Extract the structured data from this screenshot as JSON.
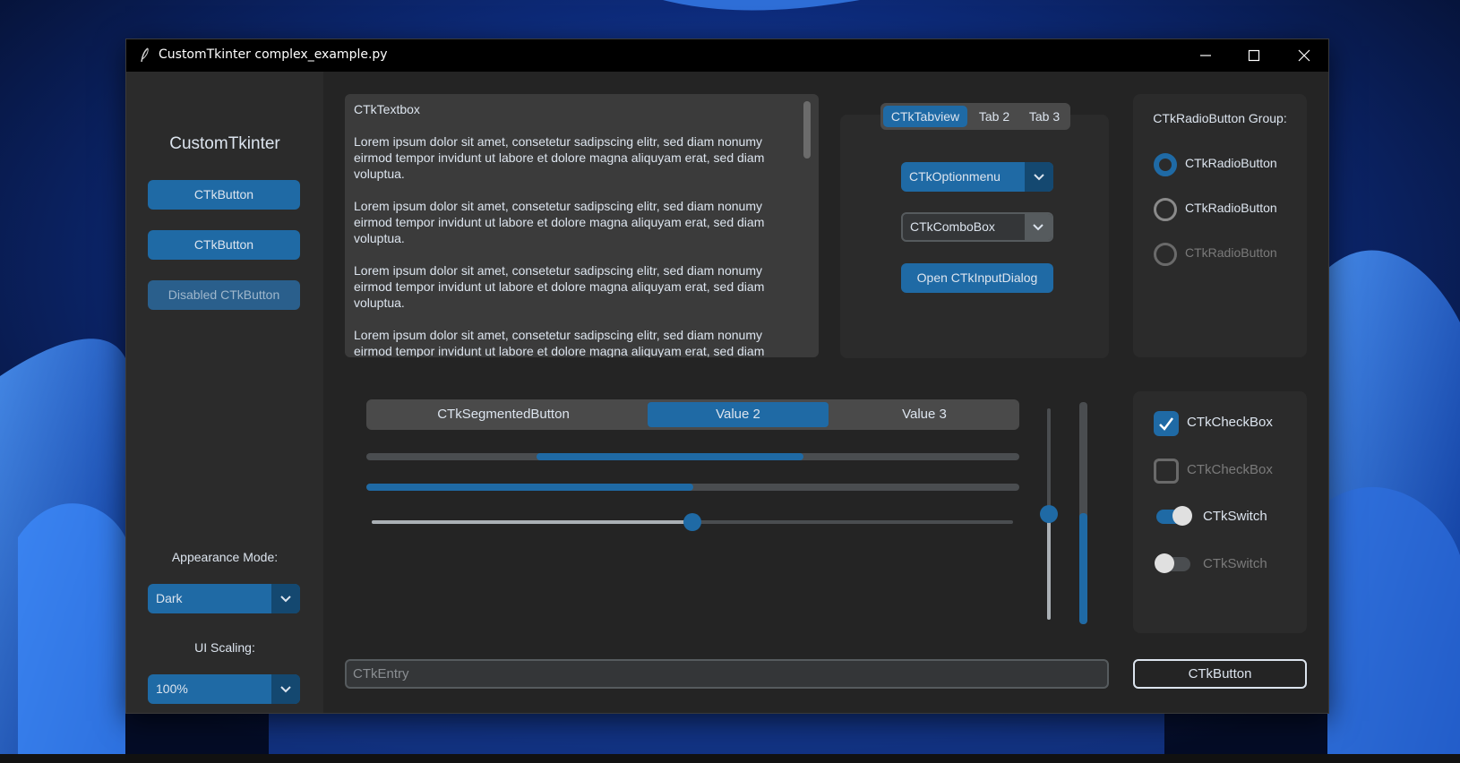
{
  "colors": {
    "accent": "#1f6aa5",
    "accent_dark": "#144870",
    "window_bg": "#242424",
    "frame_bg": "#2b2b2b",
    "text": "#dce4ee",
    "disabled_text": "#7a7a7a"
  },
  "window": {
    "title": "CustomTkinter complex_example.py",
    "icon": "feather-icon"
  },
  "sidebar": {
    "logo": "CustomTkinter",
    "buttons": [
      "CTkButton",
      "CTkButton",
      "Disabled CTkButton"
    ],
    "appearance_label": "Appearance Mode:",
    "appearance_value": "Dark",
    "scaling_label": "UI Scaling:",
    "scaling_value": "100%"
  },
  "textbox": {
    "header": "CTkTextbox",
    "paragraphs": [
      "Lorem ipsum dolor sit amet, consetetur sadipscing elitr, sed diam nonumy eirmod tempor invidunt ut labore et dolore magna aliquyam erat, sed diam voluptua.",
      "Lorem ipsum dolor sit amet, consetetur sadipscing elitr, sed diam nonumy eirmod tempor invidunt ut labore et dolore magna aliquyam erat, sed diam voluptua.",
      "Lorem ipsum dolor sit amet, consetetur sadipscing elitr, sed diam nonumy eirmod tempor invidunt ut labore et dolore magna aliquyam erat, sed diam voluptua.",
      "Lorem ipsum dolor sit amet, consetetur sadipscing elitr, sed diam nonumy eirmod tempor invidunt ut labore et dolore magna aliquyam erat, sed diam voluptua."
    ]
  },
  "tabview": {
    "tabs": [
      "CTkTabview",
      "Tab 2",
      "Tab 3"
    ],
    "active_tab": 0,
    "optionmenu_value": "CTkOptionmenu",
    "combobox_value": "CTkComboBox",
    "dialog_button": "Open CTkInputDialog"
  },
  "radio_group": {
    "title": "CTkRadioButton Group:",
    "items": [
      {
        "label": "CTkRadioButton",
        "checked": true,
        "disabled": false
      },
      {
        "label": "CTkRadioButton",
        "checked": false,
        "disabled": false
      },
      {
        "label": "CTkRadioButton",
        "checked": false,
        "disabled": true
      }
    ]
  },
  "segmented_button": {
    "values": [
      "CTkSegmentedButton",
      "Value 2",
      "Value 3"
    ],
    "selected": 1
  },
  "progressbars": {
    "indeterminate_range": [
      0.26,
      0.67
    ],
    "determinate_value": 0.5,
    "vertical_value": 0.5
  },
  "sliders": {
    "horizontal_value": 0.5,
    "vertical_value": 0.5
  },
  "checkboxes": [
    {
      "label": "CTkCheckBox",
      "checked": true,
      "disabled": false
    },
    {
      "label": "CTkCheckBox",
      "checked": false,
      "disabled": true
    }
  ],
  "switches": [
    {
      "label": "CTkSwitch",
      "on": true,
      "disabled": false
    },
    {
      "label": "CTkSwitch",
      "on": false,
      "disabled": true
    }
  ],
  "entry": {
    "placeholder": "CTkEntry"
  },
  "bottom_button": "CTkButton"
}
